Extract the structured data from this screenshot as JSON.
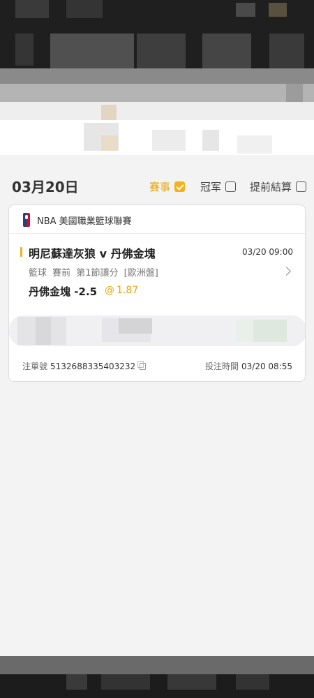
{
  "filter_bar": {
    "date": "03月20日",
    "filters": [
      {
        "label": "賽事",
        "checked": true
      },
      {
        "label": "冠军",
        "checked": false
      },
      {
        "label": "提前結算",
        "checked": false
      }
    ]
  },
  "bet_card": {
    "league": "NBA 美國職業籃球聯賽",
    "match": "明尼蘇達灰狼 v 丹佛金塊",
    "match_time": "03/20 09:00",
    "bet_type": "籃球 賽前 第1節讓分 [歐洲盤]",
    "selection": "丹佛金塊 -2.5",
    "odds_at": "@",
    "odds": "1.87",
    "bet_no_label": "注單號",
    "bet_no": "5132688335403232",
    "bet_time_label": "投注時間",
    "bet_time": "03/20 08:55"
  },
  "colors": {
    "accent": "#f5b01a",
    "background": "#f3f3f3"
  }
}
